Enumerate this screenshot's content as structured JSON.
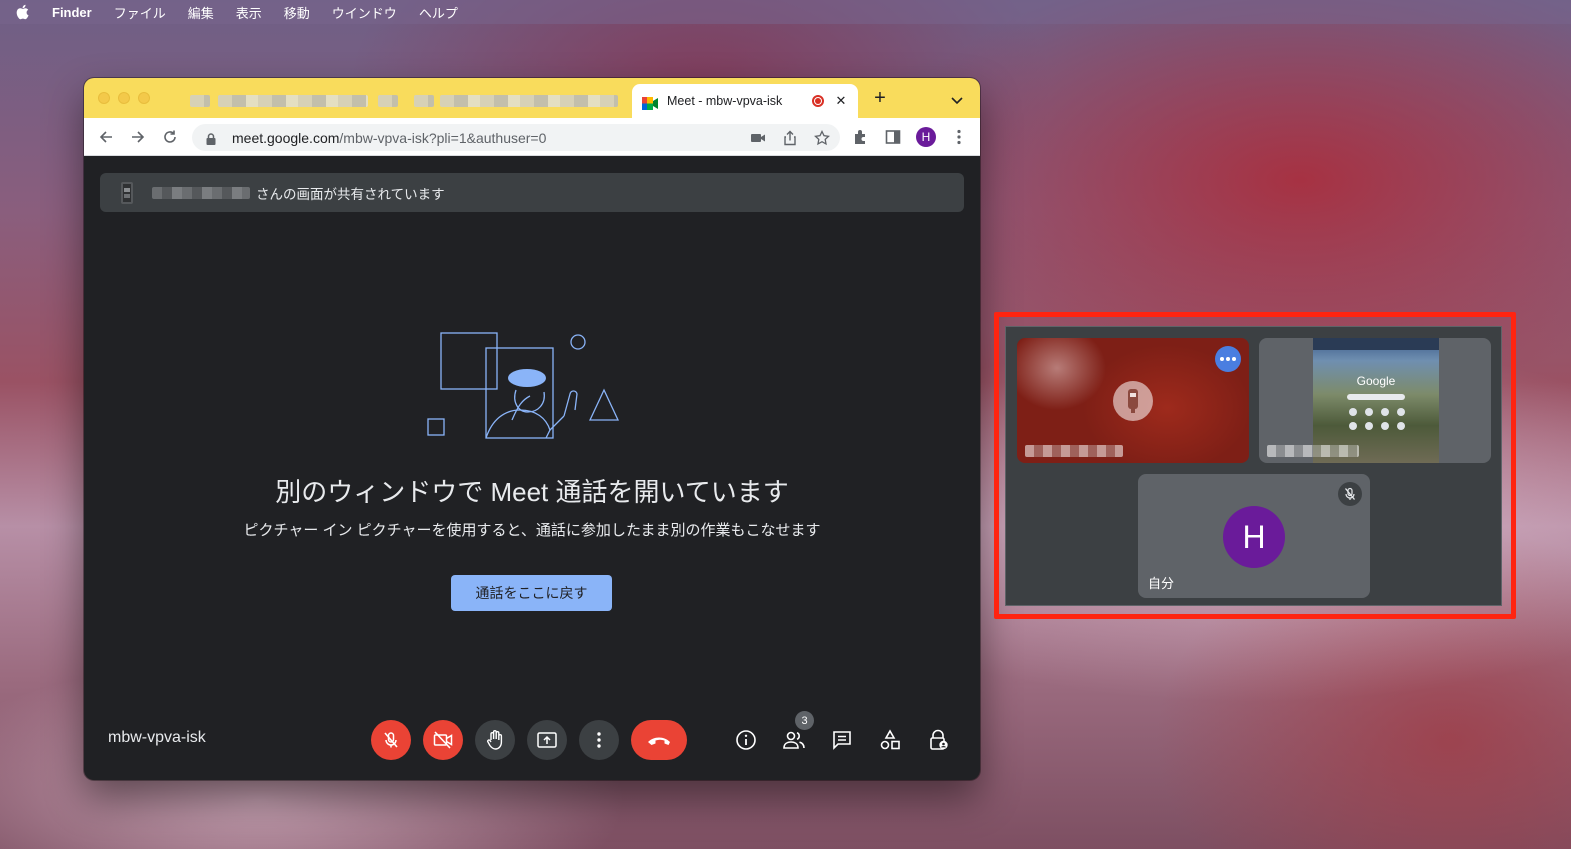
{
  "menubar": {
    "app_name": "Finder",
    "items": [
      "ファイル",
      "編集",
      "表示",
      "移動",
      "ウインドウ",
      "ヘルプ"
    ]
  },
  "browser": {
    "active_tab_title": "Meet - mbw-vpva-isk",
    "url_host": "meet.google.com",
    "url_path": "/mbw-vpva-isk?pli=1&authuser=0",
    "profile_initial": "H"
  },
  "meet": {
    "banner_text": "さんの画面が共有されています",
    "pip_title": "別のウィンドウで Meet 通話を開いています",
    "pip_subtitle": "ピクチャー イン ピクチャーを使用すると、通話に参加したまま別の作業もこなせます",
    "return_button_label": "通話をここに戻す",
    "meeting_code": "mbw-vpva-isk",
    "participant_count": "3"
  },
  "pip_window": {
    "shared_screen_logo_text": "Google",
    "self_initial": "H",
    "self_label": "自分"
  },
  "colors": {
    "tab_strip": "#f9dc5c",
    "meet_bg": "#202124",
    "danger_red": "#ea4335",
    "primary_blue": "#8ab4f8",
    "avatar_purple": "#6a1b9a",
    "highlight_red": "#ff2410"
  }
}
